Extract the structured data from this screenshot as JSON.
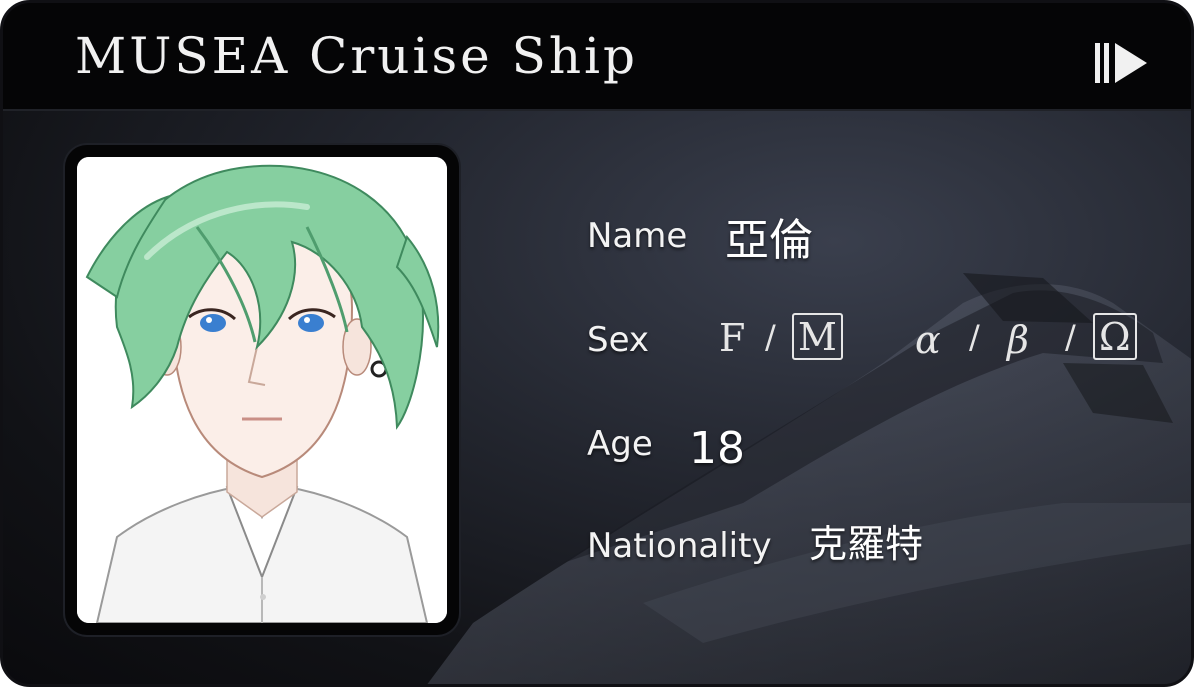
{
  "header": {
    "title": "MUSEA Cruise Ship",
    "icon": "play-forward-icon"
  },
  "fields": {
    "name": {
      "label": "Name",
      "value": "亞倫"
    },
    "sex": {
      "label": "Sex",
      "options": [
        "F",
        "M"
      ],
      "selected": "M",
      "separator": "/"
    },
    "secondary_sex": {
      "options": [
        "α",
        "β",
        "Ω"
      ],
      "selected": "Ω",
      "separator": "/"
    },
    "age": {
      "label": "Age",
      "value": "18"
    },
    "nationality": {
      "label": "Nationality",
      "value": "克羅特"
    }
  },
  "colors": {
    "header_bg": "#050506",
    "card_bg": "#23262f",
    "text": "#f3f3f3",
    "hair": "#7fc79a"
  }
}
